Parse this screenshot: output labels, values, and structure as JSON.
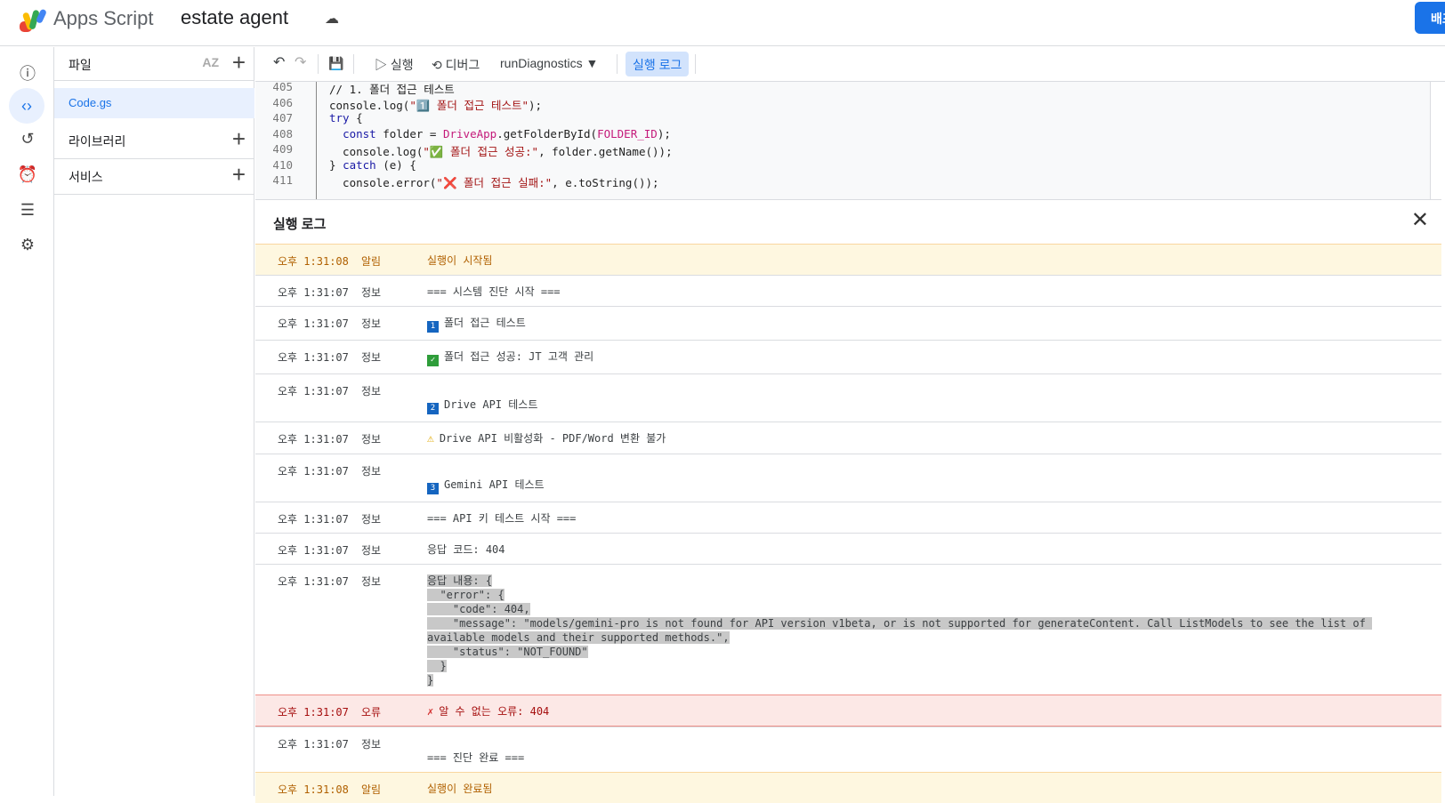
{
  "header": {
    "app_name": "Apps Script",
    "project_name": "estate agent",
    "deploy_label": "배포"
  },
  "files": {
    "title": "파일",
    "sort_label": "AZ",
    "items": [
      {
        "name": "Code.gs"
      }
    ],
    "libraries": "라이브러리",
    "services": "서비스"
  },
  "toolbar": {
    "run": "실행",
    "debug": "디버그",
    "function": "runDiagnostics",
    "exec_log": "실행 로그"
  },
  "editor": {
    "lines": [
      {
        "n": "405",
        "code": "// 1. 폴더 접근 테스트"
      },
      {
        "n": "406",
        "code": "console.log(\"1️⃣ 폴더 접근 테스트\");"
      },
      {
        "n": "407",
        "code": "try {"
      },
      {
        "n": "408",
        "code": "  const folder = DriveApp.getFolderById(FOLDER_ID);"
      },
      {
        "n": "409",
        "code": "  console.log(\"✅ 폴더 접근 성공:\", folder.getName());"
      },
      {
        "n": "410",
        "code": "} catch (e) {"
      },
      {
        "n": "411",
        "code": "  console.error(\"❌ 폴더 접근 실패:\", e.toString());"
      }
    ]
  },
  "log": {
    "title": "실행 로그",
    "rows": [
      {
        "time": "오후 1:31:08",
        "level": "알림",
        "type": "notice",
        "icon": "",
        "msg": "실행이 시작됨"
      },
      {
        "time": "오후 1:31:07",
        "level": "정보",
        "type": "info",
        "icon": "",
        "msg": "=== 시스템 진단 시작 ==="
      },
      {
        "time": "오후 1:31:07",
        "level": "정보",
        "type": "info",
        "icon": "keycap-1",
        "badge": "1",
        "msg": "폴더 접근 테스트"
      },
      {
        "time": "오후 1:31:07",
        "level": "정보",
        "type": "info",
        "icon": "check",
        "badge": "✓",
        "msg": "폴더 접근 성공: JT 고객 관리"
      },
      {
        "time": "오후 1:31:07",
        "level": "정보",
        "type": "info",
        "tall": true,
        "icon": "keycap-2",
        "badge": "2",
        "msg": "Drive API 테스트"
      },
      {
        "time": "오후 1:31:07",
        "level": "정보",
        "type": "info",
        "icon": "warning",
        "badge": "⚠",
        "msg": "Drive API 비활성화 - PDF/Word 변환 불가"
      },
      {
        "time": "오후 1:31:07",
        "level": "정보",
        "type": "info",
        "tall": true,
        "icon": "keycap-3",
        "badge": "3",
        "msg": "Gemini API 테스트"
      },
      {
        "time": "오후 1:31:07",
        "level": "정보",
        "type": "info",
        "icon": "",
        "msg": "=== API 키 테스트 시작 ==="
      },
      {
        "time": "오후 1:31:07",
        "level": "정보",
        "type": "info",
        "icon": "",
        "msg": "응답 코드: 404"
      },
      {
        "time": "오후 1:31:07",
        "level": "정보",
        "type": "info",
        "icon": "",
        "selected": true,
        "msg": "응답 내용: {\n  \"error\": {\n    \"code\": 404,\n    \"message\": \"models/gemini-pro is not found for API version v1beta, or is not supported for generateContent. Call ListModels to see the list of available models and their supported methods.\",\n    \"status\": \"NOT_FOUND\"\n  }\n}"
      },
      {
        "time": "오후 1:31:07",
        "level": "오류",
        "type": "error",
        "icon": "cross",
        "badge": "✗",
        "msg": "알 수 없는 오류: 404"
      },
      {
        "time": "오후 1:31:07",
        "level": "정보",
        "type": "info",
        "tall": true,
        "icon": "",
        "msg": "=== 진단 완료 ==="
      },
      {
        "time": "오후 1:31:08",
        "level": "알림",
        "type": "notice",
        "icon": "",
        "msg": "실행이 완료됨"
      }
    ]
  }
}
